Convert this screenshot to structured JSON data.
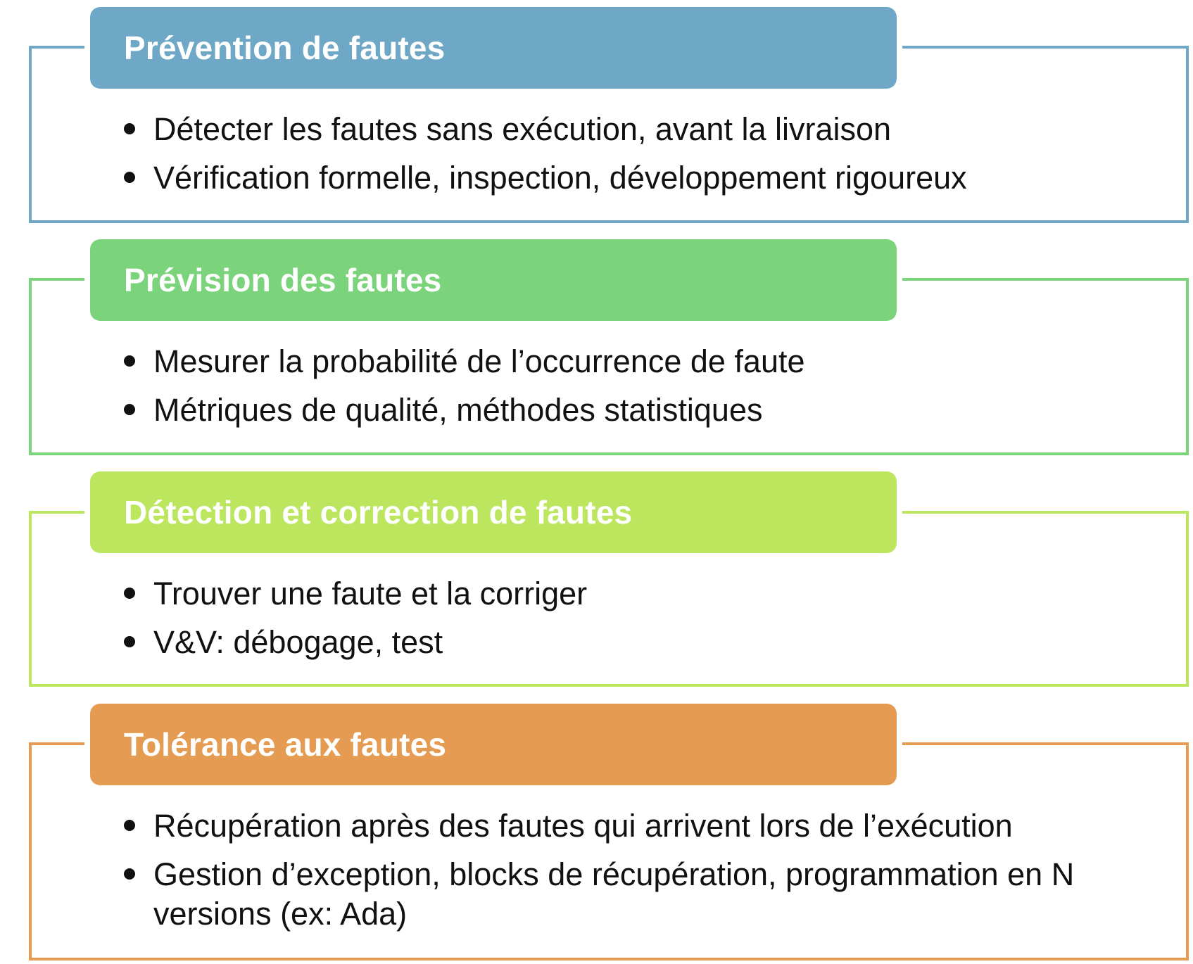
{
  "colors": {
    "prevention": "#6FA8C6",
    "prevision": "#7BD47B",
    "detection": "#BBE65E",
    "tolerance": "#E59B52"
  },
  "sections": [
    {
      "title": "Prévention de fautes",
      "bullets": [
        "Détecter les fautes sans exécution, avant la livraison",
        "Vérification formelle, inspection, développement rigoureux"
      ]
    },
    {
      "title": "Prévision des fautes",
      "bullets": [
        "Mesurer la probabilité de l’occurrence de faute",
        "Métriques de qualité, méthodes statistiques"
      ]
    },
    {
      "title": "Détection et correction de fautes",
      "bullets": [
        "Trouver une faute et la corriger",
        "V&V: débogage, test"
      ]
    },
    {
      "title": "Tolérance aux fautes",
      "bullets": [
        "Récupération après des fautes qui arrivent lors de l’exécution",
        "Gestion d’exception, blocks de récupération, programmation en N versions (ex: Ada)"
      ]
    }
  ]
}
